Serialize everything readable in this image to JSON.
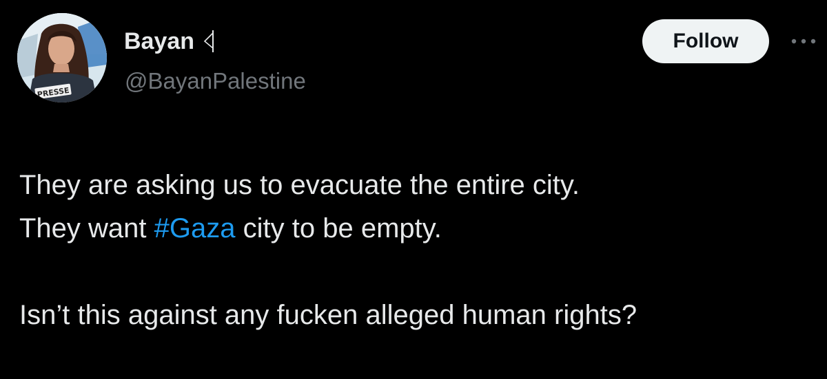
{
  "author": {
    "display_name": "Bayan",
    "handle": "@BayanPalestine",
    "flag_icon": "palestine-flag-icon"
  },
  "actions": {
    "follow_label": "Follow",
    "more_icon": "more-horizontal-icon"
  },
  "tweet": {
    "line1": "They are asking us to evacuate the entire city.",
    "line2_before": "They want ",
    "hashtag": "#Gaza",
    "line2_after": " city to be empty.",
    "line3": "Isn’t this against any fucken alleged human rights?"
  },
  "avatar": {
    "badge_text": "PRESSE"
  },
  "colors": {
    "background": "#000000",
    "text_primary": "#e7e9ea",
    "text_secondary": "#71767b",
    "link": "#1d9bf0",
    "button_bg": "#eff3f4",
    "button_text": "#0f1419"
  }
}
